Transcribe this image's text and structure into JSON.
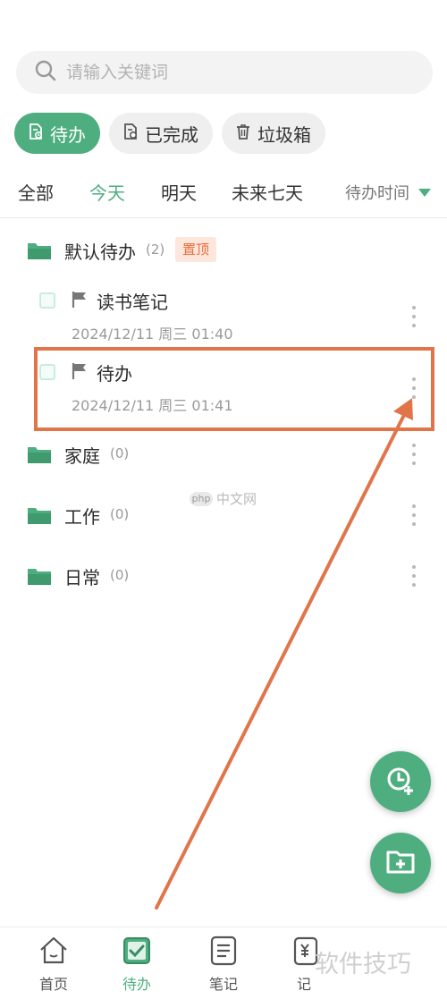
{
  "colors": {
    "accent": "#4fae80",
    "highlight": "#e2744a",
    "pin_bg": "#fde6dc",
    "pin_text": "#ec6d3b"
  },
  "search": {
    "placeholder": "请输入关键词",
    "icon": "search-icon"
  },
  "status_tabs": [
    {
      "label": "待办",
      "icon": "todo-doc-icon",
      "active": true
    },
    {
      "label": "已完成",
      "icon": "done-doc-icon",
      "active": false
    },
    {
      "label": "垃圾箱",
      "icon": "trash-icon",
      "active": false
    }
  ],
  "date_filters": [
    {
      "label": "全部",
      "active": false
    },
    {
      "label": "今天",
      "active": true
    },
    {
      "label": "明天",
      "active": false
    },
    {
      "label": "未来七天",
      "active": false
    }
  ],
  "sort": {
    "label": "待办时间",
    "icon": "caret-down-icon"
  },
  "folders": [
    {
      "name": "默认待办",
      "count": "(2)",
      "pin_label": "置顶",
      "tasks": [
        {
          "title": "读书笔记",
          "date": "2024/12/11 周三 01:40"
        },
        {
          "title": "待办",
          "date": "2024/12/11 周三 01:41"
        }
      ]
    },
    {
      "name": "家庭",
      "count": "(0)"
    },
    {
      "name": "工作",
      "count": "(0)"
    },
    {
      "name": "日常",
      "count": "(0)"
    }
  ],
  "fabs": [
    {
      "icon": "add-reminder-icon"
    },
    {
      "icon": "add-folder-icon"
    }
  ],
  "watermark": {
    "badge": "php",
    "text": "中文网"
  },
  "bottom_nav": [
    {
      "label": "首页",
      "icon": "home-icon",
      "active": false
    },
    {
      "label": "待办",
      "icon": "todo-check-icon",
      "active": true
    },
    {
      "label": "笔记",
      "icon": "note-icon",
      "active": false
    },
    {
      "label": "记",
      "icon": "ledger-icon",
      "active": false
    }
  ],
  "corner_watermark": "软件技巧"
}
